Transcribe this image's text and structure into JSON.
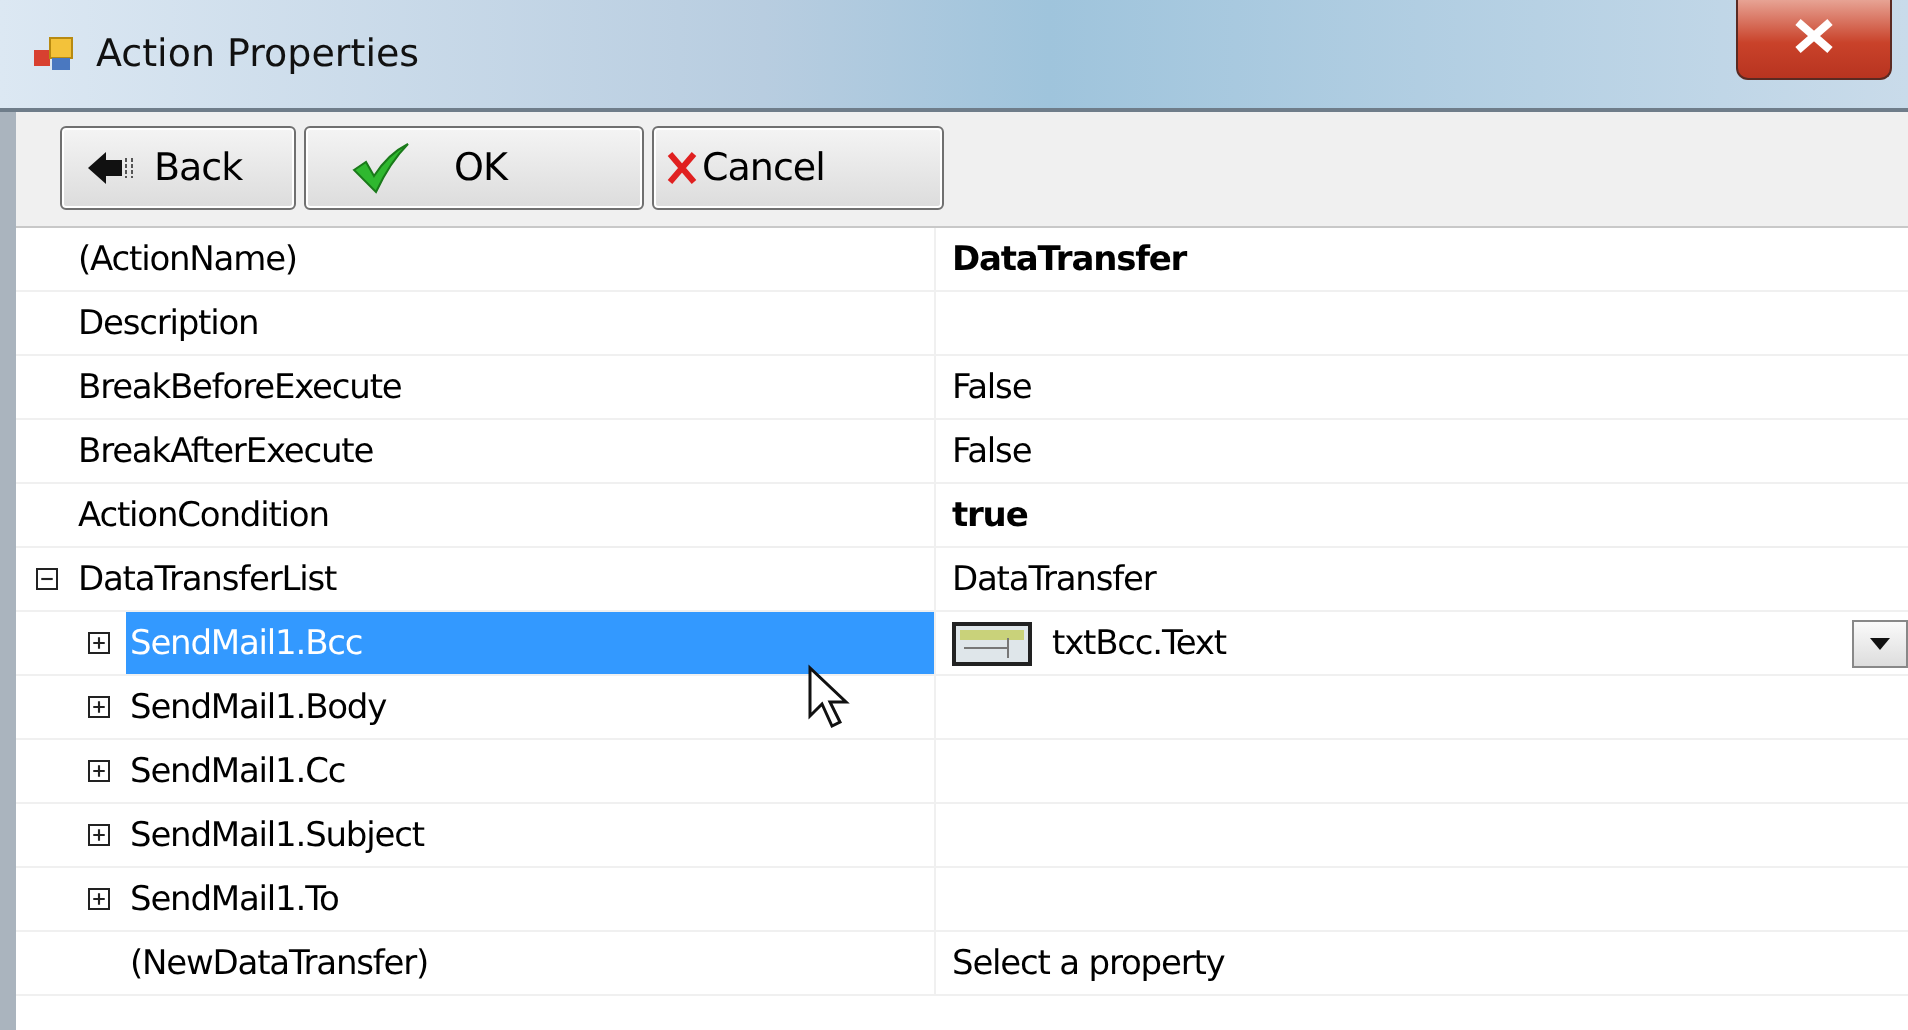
{
  "window": {
    "title": "Action Properties"
  },
  "toolbar": [
    {
      "kind": "back",
      "label": "Back"
    },
    {
      "kind": "ok",
      "label": "OK"
    },
    {
      "kind": "cancel",
      "label": "Cancel"
    }
  ],
  "properties": [
    {
      "name": "(ActionName)",
      "value": "DataTransfer",
      "modified": true,
      "selected": false
    },
    {
      "name": "Description",
      "selected": false
    },
    {
      "name": "BreakBeforeExecute",
      "value": "False",
      "modified": false,
      "selected": false
    },
    {
      "name": "BreakAfterExecute",
      "value": "False",
      "modified": false,
      "selected": false
    },
    {
      "name": "ActionCondition",
      "value": "true",
      "modified": true,
      "selected": false
    },
    {
      "name": "DataTransferList",
      "value": "DataTransfer",
      "modified": false,
      "selected": false,
      "expanded": true,
      "children": [
        {
          "name": "SendMail1.Bcc",
          "value": "txtBcc.Text",
          "modified": false,
          "selected": true,
          "expanded": false,
          "has_dropdown": true
        },
        {
          "name": "SendMail1.Body",
          "selected": false,
          "expanded": false
        },
        {
          "name": "SendMail1.Cc",
          "selected": false,
          "expanded": false
        },
        {
          "name": "SendMail1.Subject",
          "selected": false,
          "expanded": false
        },
        {
          "name": "SendMail1.To",
          "selected": false,
          "expanded": false
        },
        {
          "name": "(NewDataTransfer)",
          "value": "Select a property",
          "modified": false,
          "selected": false
        }
      ]
    }
  ]
}
